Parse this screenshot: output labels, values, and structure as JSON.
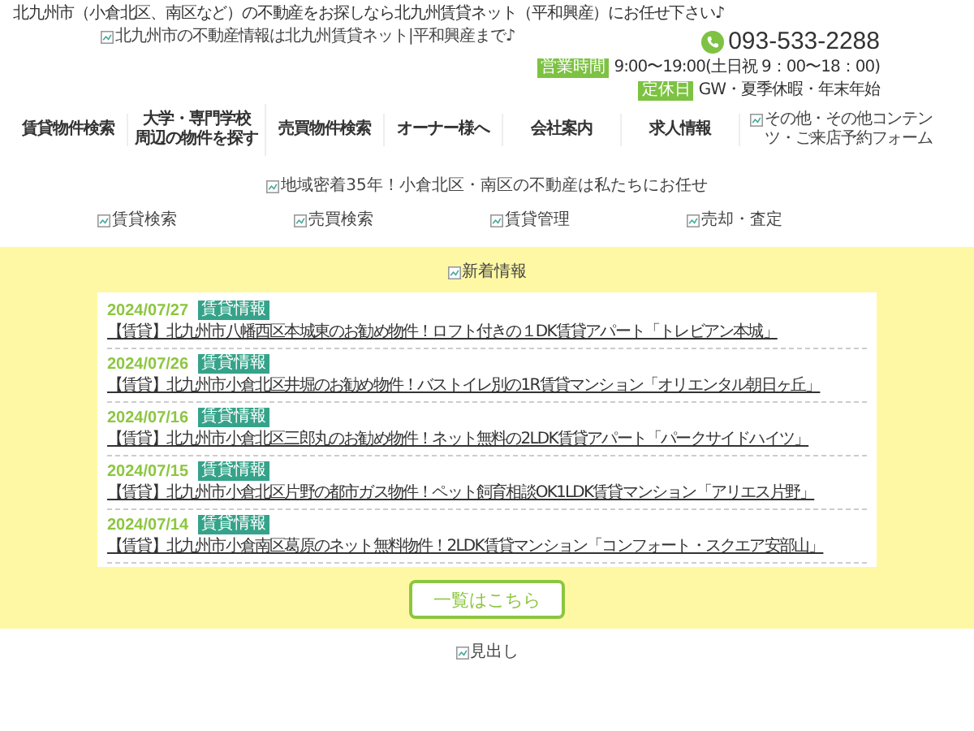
{
  "top_tagline": "北九州市（小倉北区、南区など）の不動産をお探しなら北九州賃貸ネット（平和興産）にお任せ下さい♪",
  "header": {
    "logo_alt": "北九州市の不動産情報は北九州賃貸ネット|平和興産まで♪",
    "phone": "093-533-2288",
    "hours": [
      {
        "label": "営業時間",
        "value": "9:00〜19:00(土日祝 9：00〜18：00)"
      },
      {
        "label": "定休日",
        "value": "GW・夏季休暇・年末年始"
      }
    ]
  },
  "nav": {
    "items": [
      {
        "lines": [
          "賃貸物件検索"
        ]
      },
      {
        "lines": [
          "大学・専門学校",
          "周辺の物件を探す"
        ]
      },
      {
        "lines": [
          "売買物件検索"
        ]
      },
      {
        "lines": [
          "オーナー様へ"
        ]
      },
      {
        "lines": [
          "会社案内"
        ]
      },
      {
        "lines": [
          "求人情報"
        ]
      }
    ],
    "extra_alt": "その他・その他コンテンツ・ご来店予約フォーム"
  },
  "banner_alt": "地域密着35年！小倉北区・南区の不動産は私たちにお任せ",
  "category_images": [
    "賃貸検索",
    "売買検索",
    "賃貸管理",
    "売却・査定"
  ],
  "news": {
    "heading_alt": "新着情報",
    "items": [
      {
        "date": "2024/07/27",
        "tag": "賃貸情報",
        "title": "【賃貸】北九州市八幡西区本城東のお勧め物件！ロフト付きの１DK賃貸アパート「トレビアン本城」"
      },
      {
        "date": "2024/07/26",
        "tag": "賃貸情報",
        "title": "【賃貸】北九州市小倉北区井堀のお勧め物件！バストイレ別の1R賃貸マンション「オリエンタル朝日ヶ丘」"
      },
      {
        "date": "2024/07/16",
        "tag": "賃貸情報",
        "title": "【賃貸】北九州市小倉北区三郎丸のお勧め物件！ネット無料の2LDK賃貸アパート「パークサイドハイツ」"
      },
      {
        "date": "2024/07/15",
        "tag": "賃貸情報",
        "title": "【賃貸】北九州市小倉北区片野の都市ガス物件！ペット飼育相談OK1LDK賃貸マンション「アリエス片野」"
      },
      {
        "date": "2024/07/14",
        "tag": "賃貸情報",
        "title": "【賃貸】北九州市小倉南区葛原のネット無料物件！2LDK賃貸マンション「コンフォート・スクエア安部山」"
      }
    ]
  },
  "more_button": "一覧はこちら",
  "footer_heading_alt": "見出し"
}
